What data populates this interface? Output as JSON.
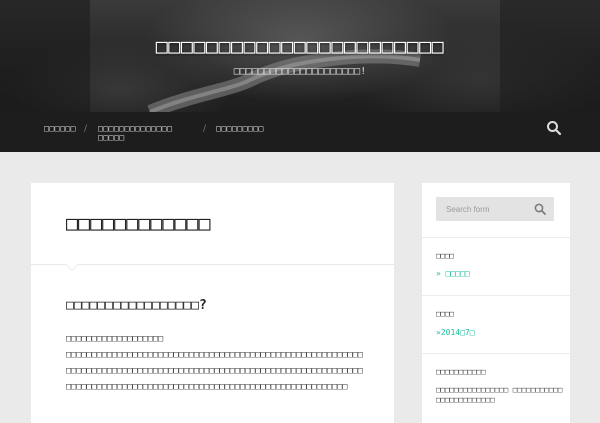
{
  "header": {
    "site_title": "□□□□□□□□□□□□□□□□□□□□□□□",
    "site_description": "□□□□□□□□□□□□□□□□□□□□□!"
  },
  "nav": {
    "items": [
      {
        "label": "□□□□□□"
      },
      {
        "label": "□□□□□□□□□□□□□□ □□□□□"
      },
      {
        "label": "□□□□□□□□□"
      }
    ],
    "search_icon": "search-icon"
  },
  "main": {
    "page_title": "□□□□□□□□□□□□",
    "post_heading": "□□□□□□□□□□□□□□□□□?",
    "post_first_line": "□□□□□□□□□□□□□□□□□□□",
    "post_body": "□□□□□□□□□□□□□□□□□□□□□□□□□□□□□□□□□□□□□□□□□□□□□□□□□□□□□□□□□□□□□□□□□□□□□□□□□□□□□□□□□□□□□□□□□□□□□□□□□□□□□□□□□□□□□□□□□□□□□□□□□□□□□□□□□□□□□□□□□□□□□□□□□□□□□□□□□□□□□□□□□□□□□□□□□□□"
  },
  "sidebar": {
    "search_placeholder": "Search form",
    "widgets": [
      {
        "title": "□□□□",
        "link": "» □□□□□"
      },
      {
        "title": "□□□□",
        "link": "»2014□7□"
      },
      {
        "title": "□□□□□□□□□□□",
        "text": "□□□□□□□□□□□□□□□□ □□□□□□□□□□□□□□□□□□□□□□□□"
      }
    ]
  },
  "colors": {
    "accent": "#1abc9c",
    "nav_bg": "#1d1d1d",
    "page_bg": "#eaeaea"
  }
}
